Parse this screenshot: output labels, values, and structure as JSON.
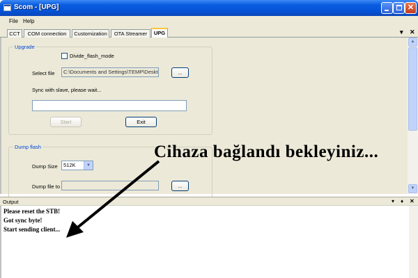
{
  "window": {
    "title": "Scom - [UPG]"
  },
  "menu": {
    "file": "File",
    "help": "Help"
  },
  "tabs": [
    {
      "label": "CCT"
    },
    {
      "label": "COM connection"
    },
    {
      "label": "Customization"
    },
    {
      "label": "OTA Streamer"
    },
    {
      "label": "UPG",
      "active": true
    }
  ],
  "upgrade": {
    "title": "Upgrade",
    "divide_flash_label": "Divide_flash_mode",
    "select_file_label": "Select file",
    "select_file_value": "C:\\Documents and Settings\\TEMP\\Desktop\\s",
    "browse_label": "...",
    "status_text": "Sync with slave, please wait...",
    "progress_text": "",
    "start_label": "Start",
    "exit_label": "Exit"
  },
  "dump": {
    "title": "Dump flash",
    "size_label": "Dump Size",
    "size_value": "512K",
    "file_label": "Dump file to",
    "file_value": "",
    "browse_label": "..."
  },
  "overlay_text": "Cihaza bağlandı bekleyiniz...",
  "output": {
    "title": "Output",
    "lines": [
      "Please reset the STB!",
      "Got sync byte!",
      "Start sending client..."
    ]
  },
  "icons": {
    "minimize": "minimize-icon",
    "maximize": "maximize-icon",
    "close": "close-icon",
    "arrow": "annotation-arrow-icon"
  }
}
